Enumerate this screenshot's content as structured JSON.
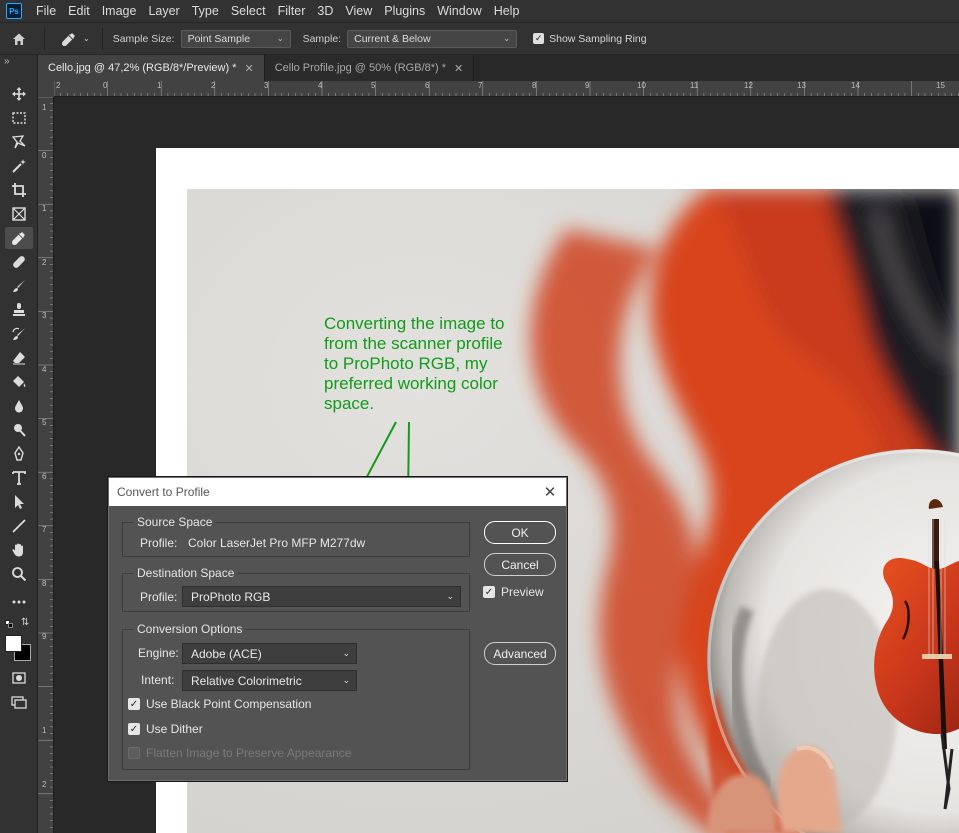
{
  "app": {
    "logo_text": "Ps"
  },
  "menu": [
    "File",
    "Edit",
    "Image",
    "Layer",
    "Type",
    "Select",
    "Filter",
    "3D",
    "View",
    "Plugins",
    "Window",
    "Help"
  ],
  "options_bar": {
    "sample_size_label": "Sample Size:",
    "sample_size_value": "Point Sample",
    "sample_label": "Sample:",
    "sample_value": "Current & Below",
    "show_ring_label": "Show Sampling Ring",
    "show_ring_checked": true
  },
  "tabs": [
    {
      "label": "Cello.jpg @ 47,2% (RGB/8*/Preview) *",
      "active": true
    },
    {
      "label": "Cello Profile.jpg @ 50% (RGB/8*) *",
      "active": false
    }
  ],
  "rulers": {
    "horizontal": [
      "2",
      "0",
      "1",
      "2",
      "3",
      "4",
      "5",
      "6",
      "7",
      "8",
      "9",
      "10",
      "11",
      "12",
      "13",
      "14",
      "15"
    ],
    "vertical": [
      "1",
      "0",
      "1",
      "2",
      "3",
      "4",
      "5",
      "6",
      "7",
      "8",
      "9",
      "1",
      "2"
    ]
  },
  "annotation": {
    "text": "Converting the image to from the scanner profile to ProPhoto RGB, my preferred working color space.",
    "color": "#119b1b"
  },
  "dialog": {
    "title": "Convert to Profile",
    "source_space": {
      "legend": "Source Space",
      "profile_label": "Profile:",
      "profile_value": "Color LaserJet Pro MFP M277dw"
    },
    "destination_space": {
      "legend": "Destination Space",
      "profile_label": "Profile:",
      "profile_value": "ProPhoto RGB"
    },
    "conversion_options": {
      "legend": "Conversion Options",
      "engine_label": "Engine:",
      "engine_value": "Adobe (ACE)",
      "intent_label": "Intent:",
      "intent_value": "Relative Colorimetric",
      "black_point_label": "Use Black Point Compensation",
      "black_point_checked": true,
      "dither_label": "Use Dither",
      "dither_checked": true,
      "flatten_label": "Flatten Image to Preserve Appearance",
      "flatten_enabled": false
    },
    "buttons": {
      "ok": "OK",
      "cancel": "Cancel",
      "advanced": "Advanced"
    },
    "preview_label": "Preview",
    "preview_checked": true
  },
  "colors": {
    "ui_dark": "#323232",
    "canvas_bg": "#282828",
    "accent_blue": "#31a8ff",
    "cello_red": "#c8361b"
  }
}
